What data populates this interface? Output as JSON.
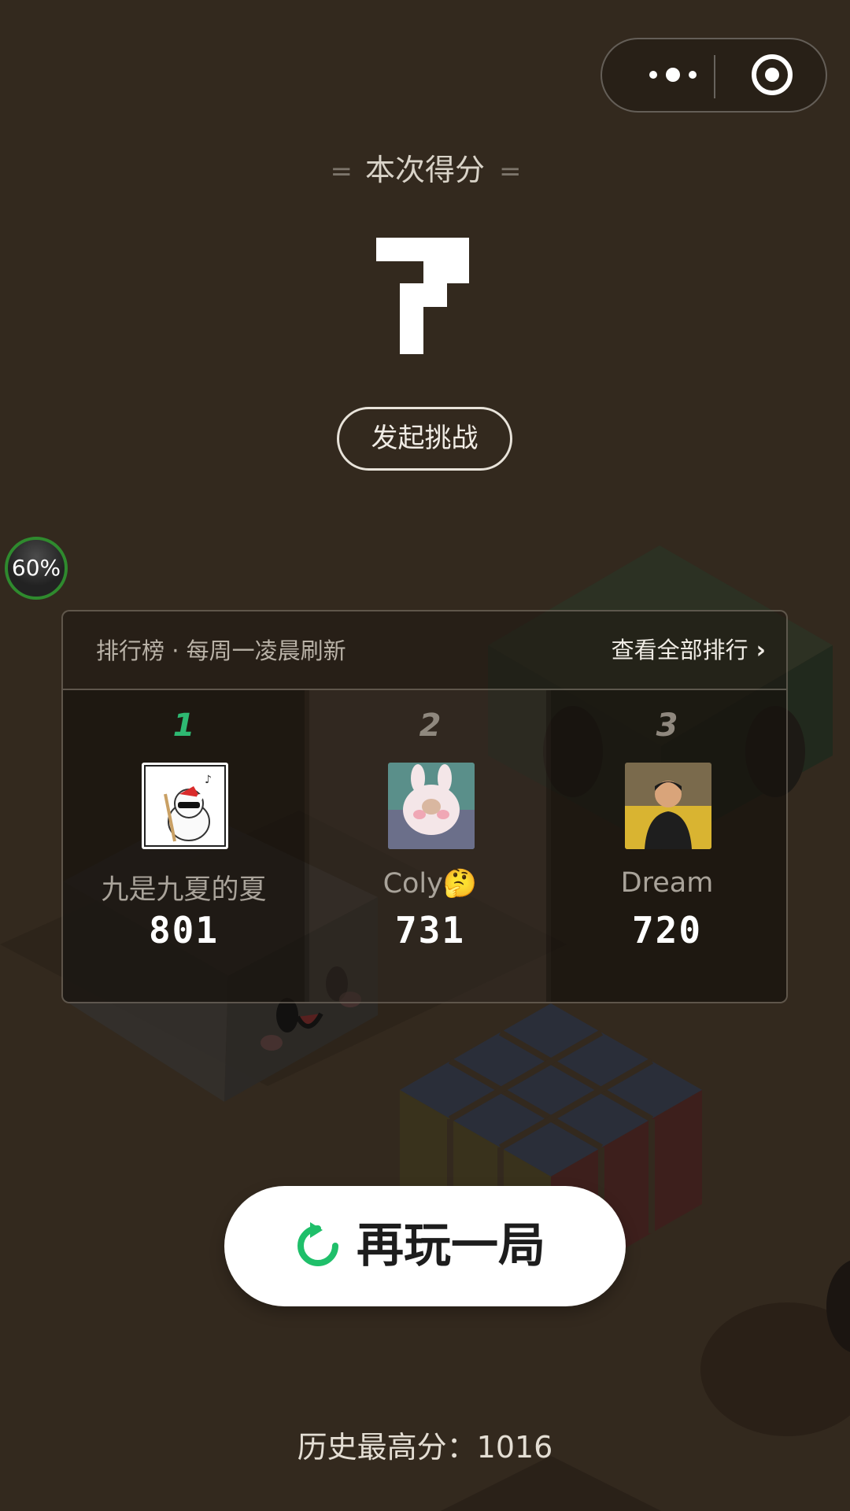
{
  "score_label": "本次得分",
  "score": "7",
  "challenge_label": "发起挑战",
  "progress_badge": "60%",
  "leaderboard": {
    "title": "排行榜 · 每周一凌晨刷新",
    "view_all": "查看全部排行",
    "entries": [
      {
        "rank": "1",
        "name": "九是九夏的夏",
        "score": "801"
      },
      {
        "rank": "2",
        "name": "Coly🤔",
        "score": "731"
      },
      {
        "rank": "3",
        "name": "Dream",
        "score": "720"
      }
    ]
  },
  "replay_label": "再玩一局",
  "best_score": "历史最高分：1016",
  "colors": {
    "background": "#33291e",
    "rank1": "#2eb872",
    "rank_other": "#8f887e",
    "replay_icon": "#1fbf6a",
    "progress_ring": "#2f8a2e"
  }
}
